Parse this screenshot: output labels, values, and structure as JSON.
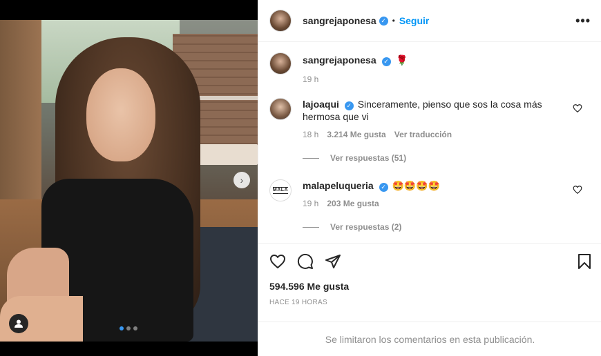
{
  "header": {
    "username": "sangrejaponesa",
    "separator": "•",
    "follow_label": "Seguir",
    "more_icon": "more-horizontal-icon"
  },
  "caption": {
    "username": "sangrejaponesa",
    "text": "🌹",
    "time": "19 h"
  },
  "comments": [
    {
      "username": "lajoaqui",
      "text": "Sinceramente, pienso que sos la cosa más hermosa que vi",
      "time": "18 h",
      "likes": "3.214 Me gusta",
      "translate": "Ver traducción",
      "replies": "Ver respuestas (51)"
    },
    {
      "username": "malapeluqueria",
      "avatar_text": "MALA",
      "text": "🤩🤩🤩🤩",
      "time": "19 h",
      "likes": "203 Me gusta",
      "replies": "Ver respuestas (2)"
    }
  ],
  "actions": {
    "like_icon": "heart-icon",
    "comment_icon": "comment-icon",
    "share_icon": "paper-plane-icon",
    "save_icon": "bookmark-icon"
  },
  "likes_count": "594.596 Me gusta",
  "timestamp": "HACE 19 HORAS",
  "comments_limited": "Se limitaron los comentarios en esta publicación.",
  "media": {
    "carousel_position": 1,
    "carousel_total": 3
  },
  "colors": {
    "accent": "#0095f6",
    "verified": "#3897f0",
    "muted": "#8e8e8e",
    "text": "#262626"
  }
}
